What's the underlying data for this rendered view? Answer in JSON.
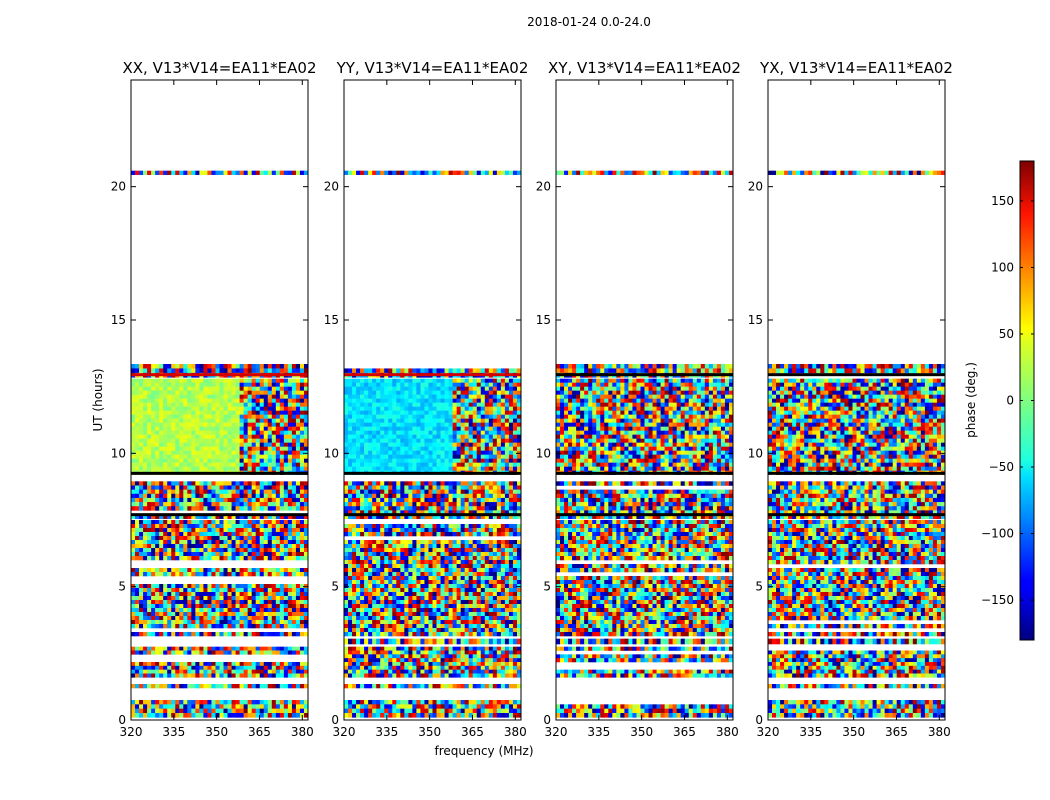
{
  "figure": {
    "suptitle": "2018-01-24 0.0-24.0"
  },
  "chart_data": [
    {
      "type": "heatmap",
      "title": "XX, V13*V14=EA11*EA02",
      "xlabel": "",
      "ylabel": "UT (hours)",
      "xlim": [
        320,
        382
      ],
      "ylim": [
        0,
        24
      ],
      "xticks": [
        "320",
        "335",
        "350",
        "365",
        "380"
      ],
      "yticks": [
        "0",
        "5",
        "10",
        "15",
        "20"
      ]
    },
    {
      "type": "heatmap",
      "title": "YY, V13*V14=EA11*EA02",
      "xlabel": "frequency (MHz)",
      "ylabel": "",
      "xlim": [
        320,
        382
      ],
      "ylim": [
        0,
        24
      ],
      "xticks": [
        "320",
        "335",
        "350",
        "365",
        "380"
      ],
      "yticks": [
        "0",
        "5",
        "10",
        "15",
        "20"
      ]
    },
    {
      "type": "heatmap",
      "title": "XY, V13*V14=EA11*EA02",
      "xlabel": "",
      "ylabel": "",
      "xlim": [
        320,
        382
      ],
      "ylim": [
        0,
        24
      ],
      "xticks": [
        "320",
        "335",
        "350",
        "365",
        "380"
      ],
      "yticks": [
        "0",
        "5",
        "10",
        "15",
        "20"
      ]
    },
    {
      "type": "heatmap",
      "title": "YX, V13*V14=EA11*EA02",
      "xlabel": "",
      "ylabel": "",
      "xlim": [
        320,
        382
      ],
      "ylim": [
        0,
        24
      ],
      "xticks": [
        "320",
        "335",
        "350",
        "365",
        "380"
      ],
      "yticks": [
        "0",
        "5",
        "10",
        "15",
        "20"
      ]
    }
  ],
  "colorbar": {
    "label": "phase (deg.)",
    "range": [
      -180,
      180
    ],
    "ticks": [
      "150",
      "100",
      "50",
      "0",
      "−50",
      "−100",
      "−150"
    ],
    "colormap": "jet"
  }
}
